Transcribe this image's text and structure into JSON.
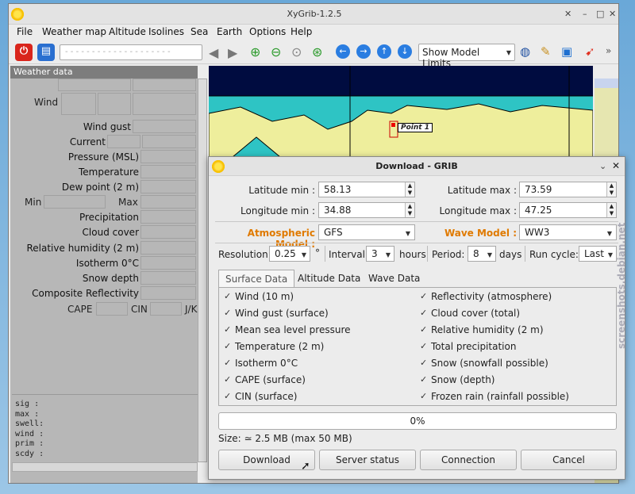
{
  "window": {
    "title": "XyGrib-1.2.5"
  },
  "menu": [
    "File",
    "Weather map",
    "Altitude",
    "Isolines",
    "Sea",
    "Earth",
    "Options",
    "Help"
  ],
  "toolbar": {
    "model_limits": "Show Model Limits"
  },
  "left_panel": {
    "title": "Weather data",
    "wind": "Wind",
    "wind_gust": "Wind gust",
    "current": "Current",
    "pressure": "Pressure (MSL)",
    "temperature": "Temperature",
    "dew_point": "Dew point (2 m)",
    "min": "Min",
    "max": "Max",
    "precipitation": "Precipitation",
    "cloud_cover": "Cloud cover",
    "rel_humidity": "Relative humidity (2 m)",
    "isotherm": "Isotherm 0°C",
    "snow_depth": "Snow depth",
    "composite_reflectivity": "Composite Reflectivity",
    "cape": "CAPE",
    "cin": "CIN",
    "jk": "J/K",
    "bottom_lines": [
      "sig  :",
      "max  :",
      "swell:",
      "wind :",
      "prim :",
      "scdy :"
    ]
  },
  "map": {
    "point_label": "Point 1"
  },
  "dialog": {
    "title": "Download - GRIB",
    "lat_min_label": "Latitude min :",
    "lat_min": "58.13",
    "lat_max_label": "Latitude max :",
    "lat_max": "73.59",
    "lon_min_label": "Longitude min :",
    "lon_min": "34.88",
    "lon_max_label": "Longitude max :",
    "lon_max": "47.25",
    "atm_model_label": "Atmospheric Model :",
    "atm_model": "GFS",
    "wave_model_label": "Wave Model :",
    "wave_model": "WW3",
    "resolution_label": "Resolution:",
    "resolution": "0.25",
    "resolution_unit": "°",
    "interval_label": "Interval:",
    "interval": "3",
    "interval_unit": "hours",
    "period_label": "Period:",
    "period": "8",
    "period_unit": "days",
    "run_cycle_label": "Run cycle:",
    "run_cycle": "Last",
    "tabs": [
      "Surface Data",
      "Altitude Data",
      "Wave Data"
    ],
    "checks_left": [
      "Wind (10 m)",
      "Wind gust (surface)",
      "Mean sea level pressure",
      "Temperature (2 m)",
      "Isotherm 0°C",
      "CAPE (surface)",
      "CIN (surface)"
    ],
    "checks_right": [
      "Reflectivity (atmosphere)",
      "Cloud cover (total)",
      "Relative humidity (2 m)",
      "Total precipitation",
      "Snow (snowfall possible)",
      "Snow (depth)",
      "Frozen rain (rainfall possible)"
    ],
    "progress": 0,
    "progress_text": "0%",
    "size_text": "Size: ≃ 2.5 MB (max 50 MB)",
    "btn_download": "Download",
    "btn_server": "Server status",
    "btn_connection": "Connection",
    "btn_cancel": "Cancel"
  },
  "watermark": "screenshots.debian.net",
  "colors": {
    "orange": "#e07a00",
    "sea": "#2ec4c4",
    "land": "#eeee9c",
    "map_bg": "#000c40"
  }
}
